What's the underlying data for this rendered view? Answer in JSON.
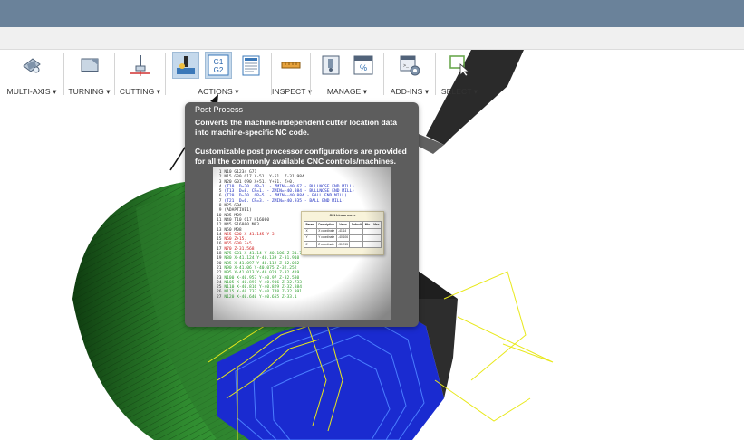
{
  "ribbon": {
    "groups": [
      {
        "label": "MULTI-AXIS ▾"
      },
      {
        "label": "TURNING ▾"
      },
      {
        "label": "CUTTING ▾"
      },
      {
        "label": "ACTIONS ▾"
      },
      {
        "label": "INSPECT ▾"
      },
      {
        "label": "MANAGE ▾"
      },
      {
        "label": "ADD-INS ▾"
      },
      {
        "label": "SELECT ▾"
      }
    ],
    "g1g2_icon_text": [
      "G1",
      "G2"
    ],
    "percent_icon_text": "%"
  },
  "tooltip": {
    "title": "Post Process",
    "description_1": "Converts the machine-independent cutter location data into machine-specific NC code.",
    "description_2": "Customizable post processor configurations are provided for all the commonly available CNC controls/machines.",
    "code_lines": [
      {
        "n": "1",
        "text": "N10 G1234 G71",
        "color": "n"
      },
      {
        "n": "2",
        "text": "N15 G30 G17 X-51. Y-51. Z-31.984",
        "color": "n"
      },
      {
        "n": "3",
        "text": "N20 G01 G90 X+51. Y+51. Z+0.",
        "color": "n"
      },
      {
        "n": "4",
        "text": "(T10  D=20. CR=1. - ZMIN=-40.67 - BULLNOSE END MILL)",
        "color": "b"
      },
      {
        "n": "5",
        "text": "(T13  D=8. CR=1. - ZMIN=-40.884 - BULLNOSE END MILL)",
        "color": "b"
      },
      {
        "n": "6",
        "text": "(T20  D=10. CR=5. - ZMIN=-40.884 - BALL END MILL)",
        "color": "b"
      },
      {
        "n": "7",
        "text": "(T21  D=6. CR=3. - ZMIN=-40.935 - BALL END MILL)",
        "color": "b"
      },
      {
        "n": "8",
        "text": "N25 G94",
        "color": "n"
      },
      {
        "n": "9",
        "text": "(ADAPTIVE1)",
        "color": "n"
      },
      {
        "n": "10",
        "text": "N35 M09",
        "color": "n"
      },
      {
        "n": "11",
        "text": "N40 T10 G17 H16000",
        "color": "n"
      },
      {
        "n": "12",
        "text": "N45 S16000 M03",
        "color": "n"
      },
      {
        "n": "13",
        "text": "N50 M08",
        "color": "n"
      },
      {
        "n": "14",
        "text": "N55 G00 X-41.145 Y-3",
        "color": "r"
      },
      {
        "n": "15",
        "text": "N60 Z+15.",
        "color": "r"
      },
      {
        "n": "16",
        "text": "N65 G00 Z+5.",
        "color": "r"
      },
      {
        "n": "17",
        "text": "N70 Z-31.568",
        "color": "r"
      },
      {
        "n": "18",
        "text": "N75 G01 X-41.14 Y-40.106 Z-31.745 F9505.",
        "color": "g"
      },
      {
        "n": "19",
        "text": "N80 X-41.124 Y-40.139 Z-31.910",
        "color": "g"
      },
      {
        "n": "20",
        "text": "N85 X-41.097 Y-40.112 Z-32.082",
        "color": "g"
      },
      {
        "n": "21",
        "text": "N90 X-41.06 Y-40.075 Z-32.252",
        "color": "g"
      },
      {
        "n": "22",
        "text": "N95 X-41.013 Y-40.028 Z-32.419",
        "color": "g"
      },
      {
        "n": "23",
        "text": "N100 X-40.957 Y-40.97 Z-32.580",
        "color": "g"
      },
      {
        "n": "24",
        "text": "N105 X-40.891 Y-40.906 Z-32.733",
        "color": "g"
      },
      {
        "n": "25",
        "text": "N110 X-40.816 Y-40.829 Z-32.884",
        "color": "g"
      },
      {
        "n": "26",
        "text": "N115 X-40.733 Y-40.748 Z-32.991",
        "color": "g"
      },
      {
        "n": "27",
        "text": "N120 X-40.640 Y-40.655 Z-33.1",
        "color": "g"
      }
    ],
    "table": {
      "title": "G01 Linear move",
      "headers": [
        "Param",
        "Description",
        "Value",
        "Default",
        "Min",
        "Max"
      ],
      "rows": [
        [
          "X",
          "X coordinate",
          "-41.14",
          "",
          "",
          ""
        ],
        [
          "Y",
          "Y coordinate",
          "-40.106",
          "",
          "",
          ""
        ],
        [
          "Z",
          "Z coordinate",
          "-31.745",
          "",
          "",
          ""
        ]
      ]
    }
  },
  "colors": {
    "title_bar": "#6a829a",
    "tooltip_bg": "#5d5d5d",
    "stock_green": "#2f8a2f",
    "toolpath_blue": "#1a2bd0",
    "toolpath_yellow": "#e8e81a"
  }
}
